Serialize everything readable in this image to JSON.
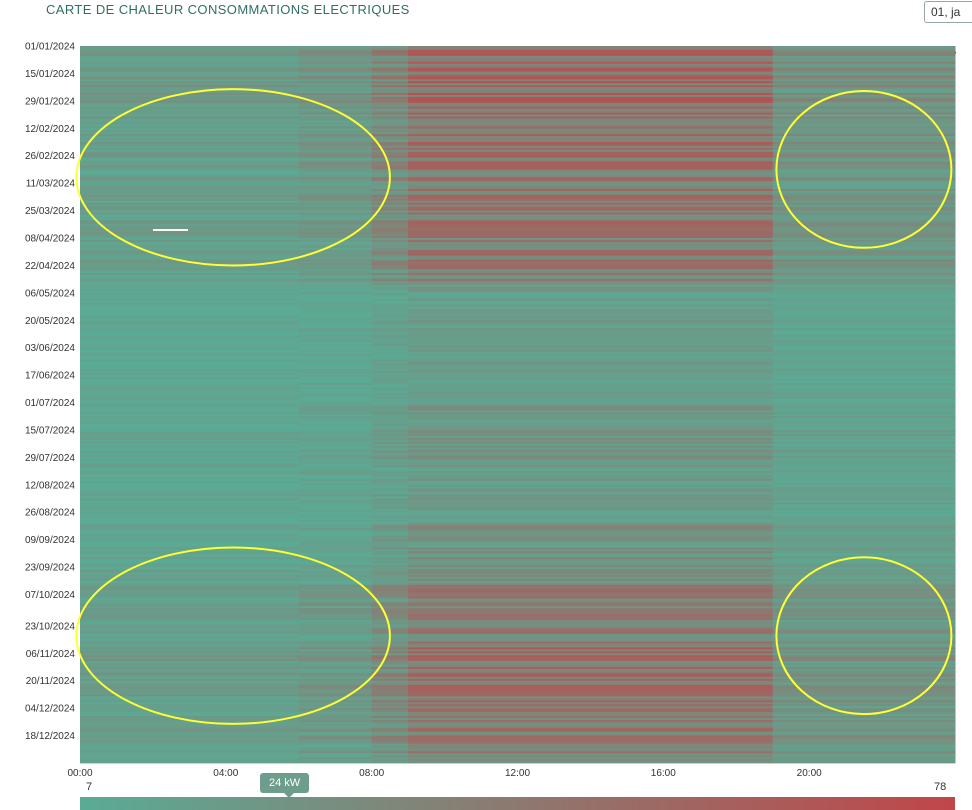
{
  "header": {
    "title": "CARTE DE CHALEUR CONSOMMATIONS ELECTRIQUES",
    "date_pill": "01, ja"
  },
  "colors": {
    "low": "#5aab95",
    "high": "#c0464a",
    "annotation": "#ffff33",
    "tooltip": "#6d9e8c"
  },
  "icons": {
    "menu": "more-dots-icon"
  },
  "chart_data": {
    "type": "heatmap",
    "title": "CARTE DE CHALEUR CONSOMMATIONS ELECTRIQUES",
    "y_ticks": [
      "01/01/2024",
      "15/01/2024",
      "29/01/2024",
      "12/02/2024",
      "26/02/2024",
      "11/03/2024",
      "25/03/2024",
      "08/04/2024",
      "22/04/2024",
      "06/05/2024",
      "20/05/2024",
      "03/06/2024",
      "17/06/2024",
      "01/07/2024",
      "15/07/2024",
      "29/07/2024",
      "12/08/2024",
      "26/08/2024",
      "09/09/2024",
      "23/09/2024",
      "07/10/2024",
      "23/10/2024",
      "06/11/2024",
      "20/11/2024",
      "04/12/2024",
      "18/12/2024"
    ],
    "x_ticks": [
      "00:00",
      "04:00",
      "08:00",
      "12:00",
      "16:00",
      "20:00"
    ],
    "x_range_hours": [
      0,
      24
    ],
    "y_range": [
      "01/01/2024",
      "31/12/2024"
    ],
    "color_scale": {
      "min": 7,
      "max": 78,
      "min_label": "7",
      "max_label": "78",
      "unit": "kW"
    },
    "tooltip_value": "24 kW",
    "tooltip_value_kw": 24,
    "profile": {
      "hour_bands": [
        {
          "from_hour": 0,
          "to_hour": 6,
          "level": 0.15
        },
        {
          "from_hour": 6,
          "to_hour": 8,
          "level": 0.2
        },
        {
          "from_hour": 8,
          "to_hour": 9,
          "level": 0.35
        },
        {
          "from_hour": 9,
          "to_hour": 19,
          "level": 0.55
        },
        {
          "from_hour": 19,
          "to_hour": 24,
          "level": 0.25
        }
      ],
      "season_weight": [
        {
          "month": 1,
          "w": 1.0
        },
        {
          "month": 2,
          "w": 0.9
        },
        {
          "month": 3,
          "w": 0.8
        },
        {
          "month": 4,
          "w": 0.75
        },
        {
          "month": 5,
          "w": 0.25
        },
        {
          "month": 6,
          "w": 0.2
        },
        {
          "month": 7,
          "w": 0.35
        },
        {
          "month": 8,
          "w": 0.3
        },
        {
          "month": 9,
          "w": 0.4
        },
        {
          "month": 10,
          "w": 0.7
        },
        {
          "month": 11,
          "w": 0.9
        },
        {
          "month": 12,
          "w": 0.8
        }
      ]
    },
    "annotations": [
      {
        "type": "ellipse",
        "cx_hour": 4.2,
        "cy_date": "08/03/2024",
        "rx_hours": 4.3,
        "ry_days": 45
      },
      {
        "type": "ellipse",
        "cx_hour": 21.5,
        "cy_date": "04/03/2024",
        "rx_hours": 2.4,
        "ry_days": 40
      },
      {
        "type": "ellipse",
        "cx_hour": 4.2,
        "cy_date": "28/10/2024",
        "rx_hours": 4.3,
        "ry_days": 45
      },
      {
        "type": "ellipse",
        "cx_hour": 21.5,
        "cy_date": "28/10/2024",
        "rx_hours": 2.4,
        "ry_days": 40
      }
    ]
  }
}
